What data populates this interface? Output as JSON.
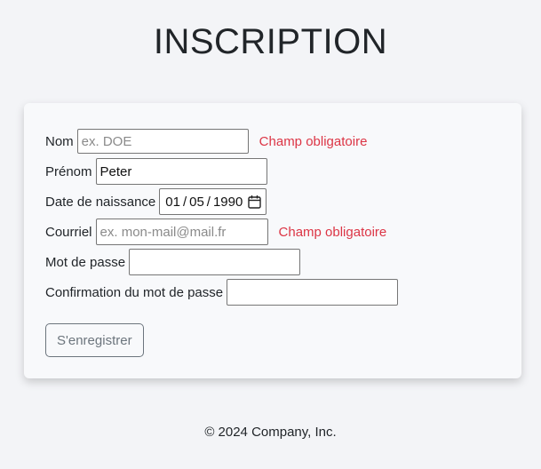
{
  "page": {
    "title": "INSCRIPTION"
  },
  "form": {
    "nom": {
      "label": "Nom",
      "value": "",
      "placeholder": "ex. DOE",
      "error": "Champ obligatoire"
    },
    "prenom": {
      "label": "Prénom",
      "value": "Peter",
      "placeholder": ""
    },
    "date_naissance": {
      "label": "Date de naissance",
      "day": "01",
      "month": "05",
      "year": "1990",
      "separator": "/"
    },
    "courriel": {
      "label": "Courriel",
      "value": "",
      "placeholder": "ex. mon-mail@mail.fr",
      "error": "Champ obligatoire"
    },
    "mot_de_passe": {
      "label": "Mot de passe",
      "value": ""
    },
    "confirmation": {
      "label": "Confirmation du mot de passe",
      "value": ""
    },
    "submit_label": "S'enregistrer"
  },
  "footer": {
    "text": "© 2024 Company, Inc."
  },
  "colors": {
    "error": "#dc3545",
    "button_border": "#6c757d",
    "background": "#f3f4f7",
    "card": "#f8f9fb"
  },
  "icons": {
    "date_picker": "calendar-icon"
  }
}
